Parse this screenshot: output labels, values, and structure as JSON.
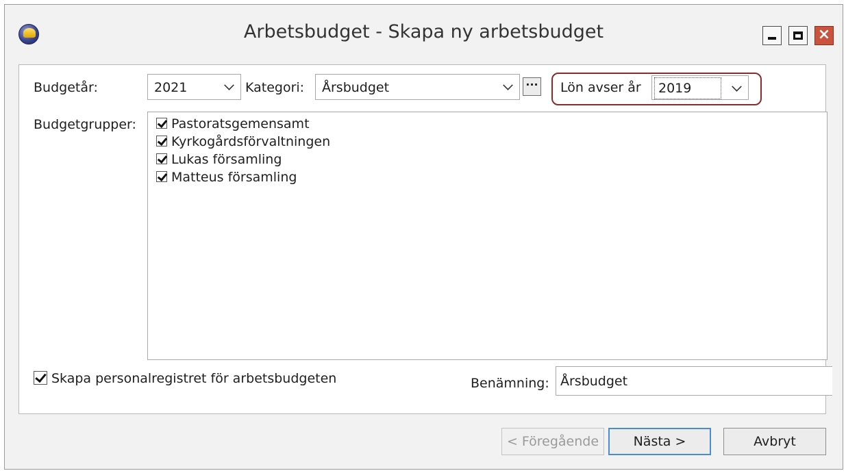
{
  "window": {
    "title": "Arbetsbudget - Skapa ny arbetsbudget",
    "close_glyph": "×",
    "icons": [
      "app-logo-icon",
      "minimize-icon",
      "maximize-icon",
      "close-icon"
    ]
  },
  "form": {
    "budgetar_label": "Budgetår:",
    "budgetar_value": "2021",
    "kategori_label": "Kategori:",
    "kategori_value": "Årsbudget",
    "ellipsis_label": "···",
    "lon_label": "Lön avser år",
    "lon_value": "2019",
    "budgetgrupper_label": "Budgetgrupper:",
    "budgetgrupper": [
      {
        "label": "Pastoratsgemensamt",
        "checked": true
      },
      {
        "label": "Kyrkogårdsförvaltningen",
        "checked": true
      },
      {
        "label": "Lukas församling",
        "checked": true
      },
      {
        "label": "Matteus församling",
        "checked": true
      }
    ],
    "skapa_label": "Skapa personalregistret för arbetsbudgeten",
    "skapa_checked": true,
    "benamning_label": "Benämning:",
    "benamning_value": "Årsbudget"
  },
  "buttons": {
    "prev": "< Föregående",
    "next": "Nästa >",
    "cancel": "Avbryt"
  },
  "colors": {
    "highlight": "#8a2a2a",
    "close_button": "#c9533d",
    "primary_border": "#4a8bd6"
  }
}
